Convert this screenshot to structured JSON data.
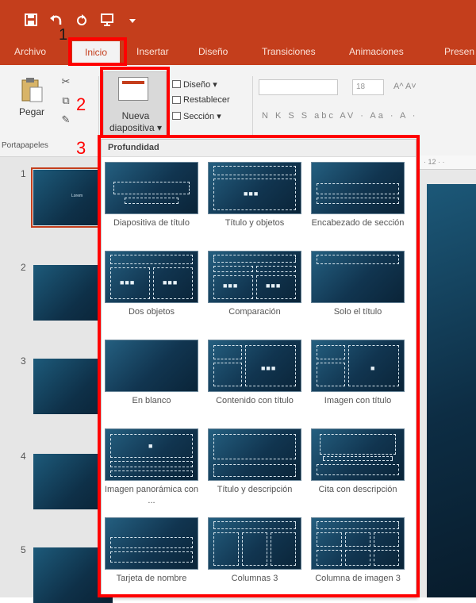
{
  "tabs": [
    "Archivo",
    "Inicio",
    "Insertar",
    "Diseño",
    "Transiciones",
    "Animaciones",
    "Presen"
  ],
  "ribbon": {
    "paste_label": "Pegar",
    "clipboard_group": "Portapapeles",
    "new_slide_line1": "Nueva",
    "new_slide_line2": "diapositiva ▾",
    "layout_label": "Diseño ▾",
    "reset_label": "Restablecer",
    "section_label": "Sección ▾",
    "font_size": "18",
    "font_row": "N K S S abc AV · Aa · A ·",
    "increase_font": "A^ A˅"
  },
  "gallery": {
    "header": "Profundidad",
    "layouts": [
      {
        "label": "Diapositiva de título"
      },
      {
        "label": "Título y objetos"
      },
      {
        "label": "Encabezado de sección"
      },
      {
        "label": "Dos objetos"
      },
      {
        "label": "Comparación"
      },
      {
        "label": "Solo el título"
      },
      {
        "label": "En blanco"
      },
      {
        "label": "Contenido con título"
      },
      {
        "label": "Imagen con título"
      },
      {
        "label": "Imagen panorámica con ..."
      },
      {
        "label": "Título y descripción"
      },
      {
        "label": "Cita con descripción"
      },
      {
        "label": "Tarjeta de nombre"
      },
      {
        "label": "Columnas 3"
      },
      {
        "label": "Columna de imagen 3"
      }
    ]
  },
  "slides": {
    "numbers": [
      "1",
      "2",
      "3",
      "4",
      "5"
    ],
    "thumb1_text": "Lorem"
  },
  "ruler_text": "· 12 · ·",
  "annotations": {
    "one": "1",
    "two": "2",
    "three": "3"
  },
  "colors": {
    "accent": "#c43e1c",
    "highlight": "#ff0000"
  }
}
